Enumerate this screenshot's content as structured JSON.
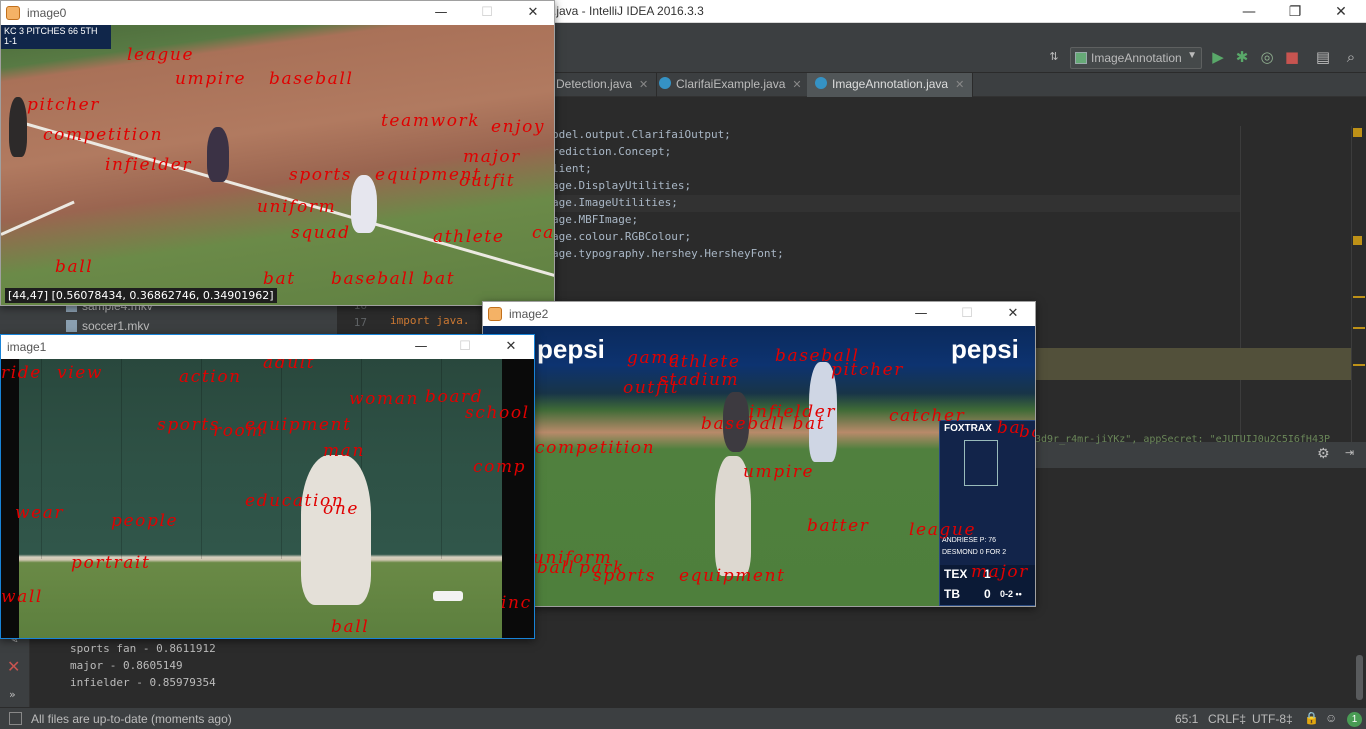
{
  "ide": {
    "title": ".java - IntelliJ IDEA 2016.3.3",
    "window_controls": [
      "—",
      "❐",
      "✕"
    ],
    "run_config": "ImageAnnotation",
    "tabs": [
      {
        "label": "Detection.java",
        "close": "✕"
      },
      {
        "label": "ClarifaiExample.java",
        "close": "✕"
      },
      {
        "label": "ImageAnnotation.java",
        "close": "✕",
        "active": true
      }
    ],
    "code_lines": [
      "odel.output.ClarifaiOutput;",
      "rediction.Concept;",
      "lient;",
      "age.DisplayUtilities;",
      "age.ImageUtilities;",
      "age.MBFImage;",
      "age.colour.RGBColour;",
      "age.typography.hershey.HersheyFont;"
    ],
    "gutter_numbers": [
      "16",
      "17"
    ],
    "import_fragment": "import java.",
    "project_files": [
      "sample4.mkv",
      "soccer1.mkv"
    ],
    "console_key_fragment": "3d9r_r4mr-jiYKz\",  appSecret: \"eJUTUIJ0u2C5I6fH43P",
    "console_lines": [
      "sports fan - 0.8611912",
      "major - 0.8605149",
      "infielder - 0.85979354"
    ],
    "status": {
      "message": "All files are up-to-date (moments ago)",
      "position": "65:1",
      "line_sep": "CRLF‡",
      "encoding": "UTF-8‡",
      "badge": "1"
    },
    "colors": {
      "editor_bg": "#2b2b2b",
      "panel_bg": "#3c3f41",
      "label_red": "#e00000"
    }
  },
  "windows": {
    "image0": {
      "title": "image0",
      "pixel_readout": "[44,47] [0.56078434, 0.36862746, 0.34901962]",
      "scorebug": "KC 3  PITCHES 66  5TH  1-1",
      "labels": [
        "league",
        "umpire",
        "baseball",
        "pitcher",
        "competition",
        "teamwork",
        "enjoy",
        "infielder",
        "major",
        "sports",
        "equipment",
        "outfit",
        "uniform",
        "squad",
        "athlete",
        "ca",
        "ball",
        "bat",
        "baseball bat"
      ]
    },
    "image1": {
      "title": "image1",
      "labels": [
        "ride",
        "view",
        "action",
        "adult",
        "woman",
        "board",
        "school",
        "sports",
        "equipment",
        "room",
        "man",
        "comp",
        "wear",
        "people",
        "education",
        "one",
        "portrait",
        "wall",
        "ball",
        "inc"
      ]
    },
    "image2": {
      "title": "image2",
      "brand": "pepsi",
      "fox_title": "FOXTRAX",
      "scoreboard": {
        "pitcher_row": "ANDRIESE  P: 76",
        "batter_row": "DESMOND  0 FOR 2",
        "team1": "TEX",
        "score1": "1",
        "team2": "TB",
        "score2": "0",
        "count": "0-2 ••"
      },
      "labels": [
        "game",
        "athlete",
        "stadium",
        "outfit",
        "baseball",
        "pitcher",
        "infielder",
        "baseball bat",
        "catcher",
        "ba",
        "competition",
        "umpire",
        "batter",
        "league",
        "uniform",
        "ball",
        "park",
        "sports",
        "equipment",
        "major",
        "ba"
      ]
    }
  }
}
